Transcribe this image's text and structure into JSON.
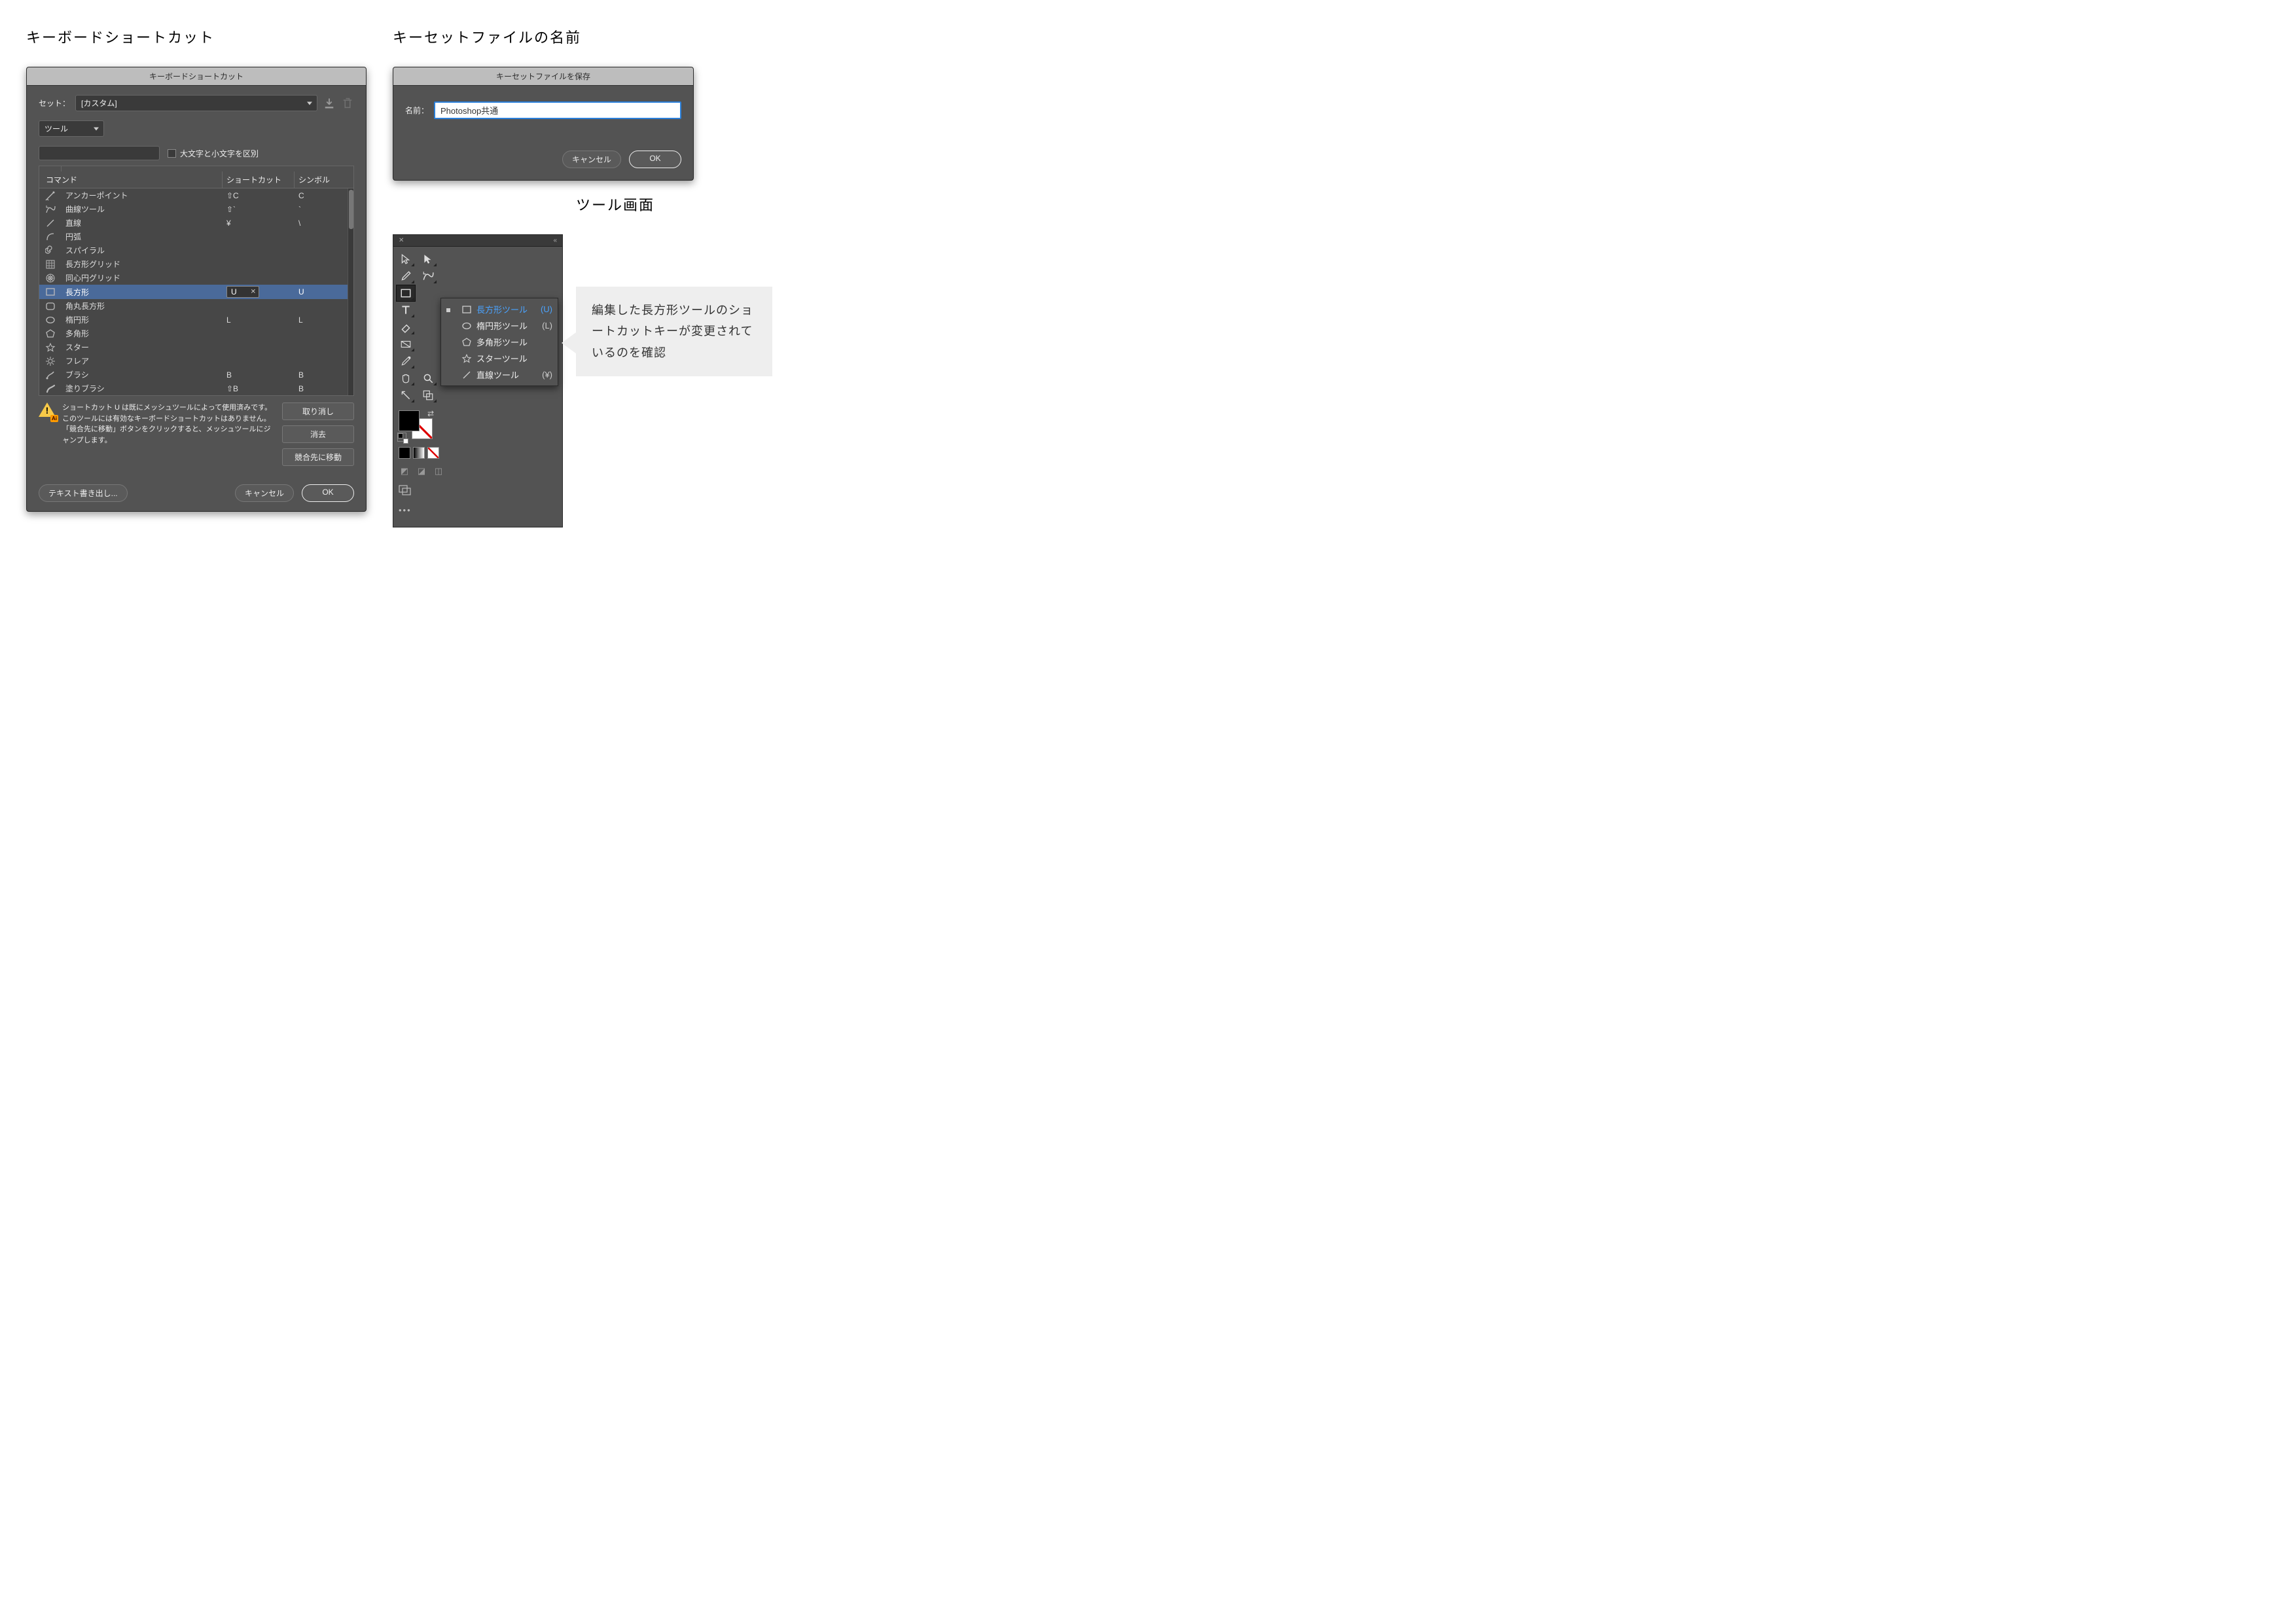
{
  "captions": {
    "shortcut_title": "キーボードショートカット",
    "save_title": "キーセットファイルの名前",
    "tool_title": "ツール画面"
  },
  "ks_dialog": {
    "title": "キーボードショートカット",
    "set_label": "セット：",
    "set_value": "[カスタム]",
    "category_value": "ツール",
    "case_sensitive_label": "大文字と小文字を区別",
    "columns": {
      "cmd": "コマンド",
      "shortcut": "ショートカット",
      "symbol": "シンボル"
    },
    "rows": [
      {
        "icon": "anchor",
        "name": "アンカーポイント",
        "shortcut": "⇧C",
        "symbol": "C"
      },
      {
        "icon": "curve",
        "name": "曲線ツール",
        "shortcut": "⇧`",
        "symbol": "`"
      },
      {
        "icon": "line",
        "name": "直線",
        "shortcut": "¥",
        "symbol": "\\"
      },
      {
        "icon": "arc",
        "name": "円弧",
        "shortcut": "",
        "symbol": ""
      },
      {
        "icon": "spiral",
        "name": "スパイラル",
        "shortcut": "",
        "symbol": ""
      },
      {
        "icon": "rectgrid",
        "name": "長方形グリッド",
        "shortcut": "",
        "symbol": ""
      },
      {
        "icon": "polargrid",
        "name": "同心円グリッド",
        "shortcut": "",
        "symbol": ""
      },
      {
        "icon": "rect",
        "name": "長方形",
        "shortcut": "U",
        "symbol": "U",
        "selected": true,
        "editing": true
      },
      {
        "icon": "roundrect",
        "name": "角丸長方形",
        "shortcut": "",
        "symbol": ""
      },
      {
        "icon": "ellipse",
        "name": "楕円形",
        "shortcut": "L",
        "symbol": "L"
      },
      {
        "icon": "polygon",
        "name": "多角形",
        "shortcut": "",
        "symbol": ""
      },
      {
        "icon": "star",
        "name": "スター",
        "shortcut": "",
        "symbol": ""
      },
      {
        "icon": "flare",
        "name": "フレア",
        "shortcut": "",
        "symbol": ""
      },
      {
        "icon": "brush",
        "name": "ブラシ",
        "shortcut": "B",
        "symbol": "B"
      },
      {
        "icon": "blob",
        "name": "塗りブラシ",
        "shortcut": "⇧B",
        "symbol": "B"
      }
    ],
    "warning_text": "ショートカット U は既にメッシュツールによって使用済みです。このツールには有効なキーボードショートカットはありません。「競合先に移動」ボタンをクリックすると、メッシュツールにジャンプします。",
    "btn_undo": "取り消し",
    "btn_clear": "消去",
    "btn_goto": "競合先に移動",
    "btn_export": "テキスト書き出し...",
    "btn_cancel": "キャンセル",
    "btn_ok": "OK"
  },
  "save_dialog": {
    "title": "キーセットファイルを保存",
    "name_label": "名前：",
    "name_value": "Photoshop共通",
    "btn_cancel": "キャンセル",
    "btn_ok": "OK"
  },
  "tool_panel": {
    "flyout": [
      {
        "icon": "rect",
        "name": "長方形ツール",
        "key": "(U)",
        "selected": true
      },
      {
        "icon": "ellipse",
        "name": "楕円形ツール",
        "key": "(L)"
      },
      {
        "icon": "polygon",
        "name": "多角形ツール",
        "key": ""
      },
      {
        "icon": "star",
        "name": "スターツール",
        "key": ""
      },
      {
        "icon": "line",
        "name": "直線ツール",
        "key": "(¥)"
      }
    ]
  },
  "callout": "編集した長方形ツールのショートカットキーが変更されているのを確認"
}
